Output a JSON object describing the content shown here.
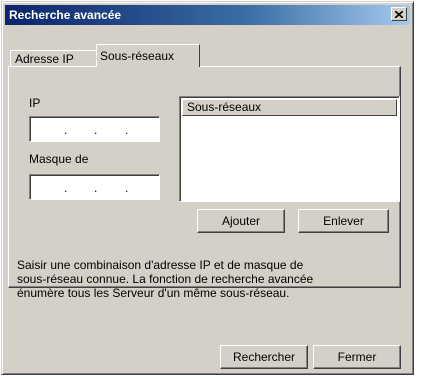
{
  "window": {
    "title": "Recherche avancée",
    "close_icon": "close-icon"
  },
  "tabs": [
    {
      "label": "Adresse IP",
      "active": false
    },
    {
      "label": "Sous-réseaux",
      "active": true
    }
  ],
  "form": {
    "ip_label": "IP",
    "ip_value": ". . .",
    "mask_label": "Masque de",
    "mask_value": ". . ."
  },
  "subnet_list": {
    "header": "Sous-réseaux",
    "items": []
  },
  "buttons": {
    "add": "Ajouter",
    "remove": "Enlever",
    "search": "Rechercher",
    "close": "Fermer"
  },
  "description": {
    "lines": [
      "Saisir une combinaison d'adresse IP et de masque de",
      "sous-réseau connue. La fonction de recherche avancée",
      "énumère tous les Serveur d'un même sous-réseau."
    ]
  }
}
